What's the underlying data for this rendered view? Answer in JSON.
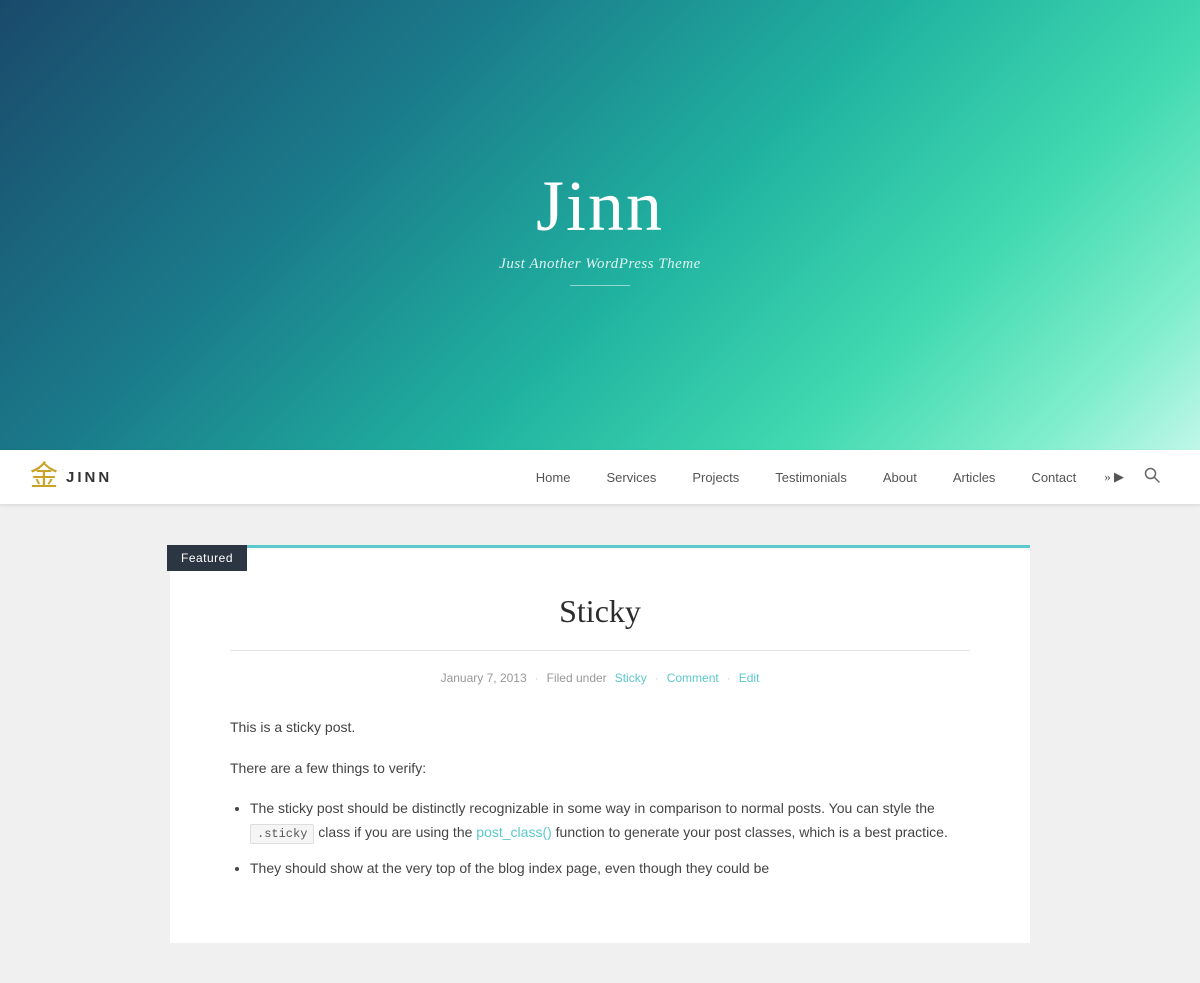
{
  "hero": {
    "title": "Jinn",
    "subtitle": "Just Another WordPress Theme"
  },
  "navbar": {
    "brand": {
      "logo": "金",
      "text": "JINN"
    },
    "nav_items": [
      {
        "label": "Home",
        "href": "#"
      },
      {
        "label": "Services",
        "href": "#"
      },
      {
        "label": "Projects",
        "href": "#"
      },
      {
        "label": "Testimonials",
        "href": "#"
      },
      {
        "label": "About",
        "href": "#"
      },
      {
        "label": "Articles",
        "href": "#"
      },
      {
        "label": "Contact",
        "href": "#"
      }
    ],
    "more_label": "»",
    "search_icon": "🔍"
  },
  "post": {
    "featured_badge": "Featured",
    "title": "Sticky",
    "meta": {
      "date": "January 7, 2013",
      "filed_under_label": "Filed under",
      "category": "Sticky",
      "comment_label": "Comment",
      "edit_label": "Edit"
    },
    "body": {
      "intro": "This is a sticky post.",
      "verify_text": "There are a few things to verify:",
      "bullets": [
        {
          "before": "The sticky post should be distinctly recognizable in some way in comparison to normal posts. You can style the ",
          "code": ".sticky",
          "middle": " class if you are using the ",
          "link": "post_class()",
          "after": " function to generate your post classes, which is a best practice."
        },
        {
          "text": "They should show at the very top of the blog index page, even though they could be"
        }
      ]
    }
  }
}
